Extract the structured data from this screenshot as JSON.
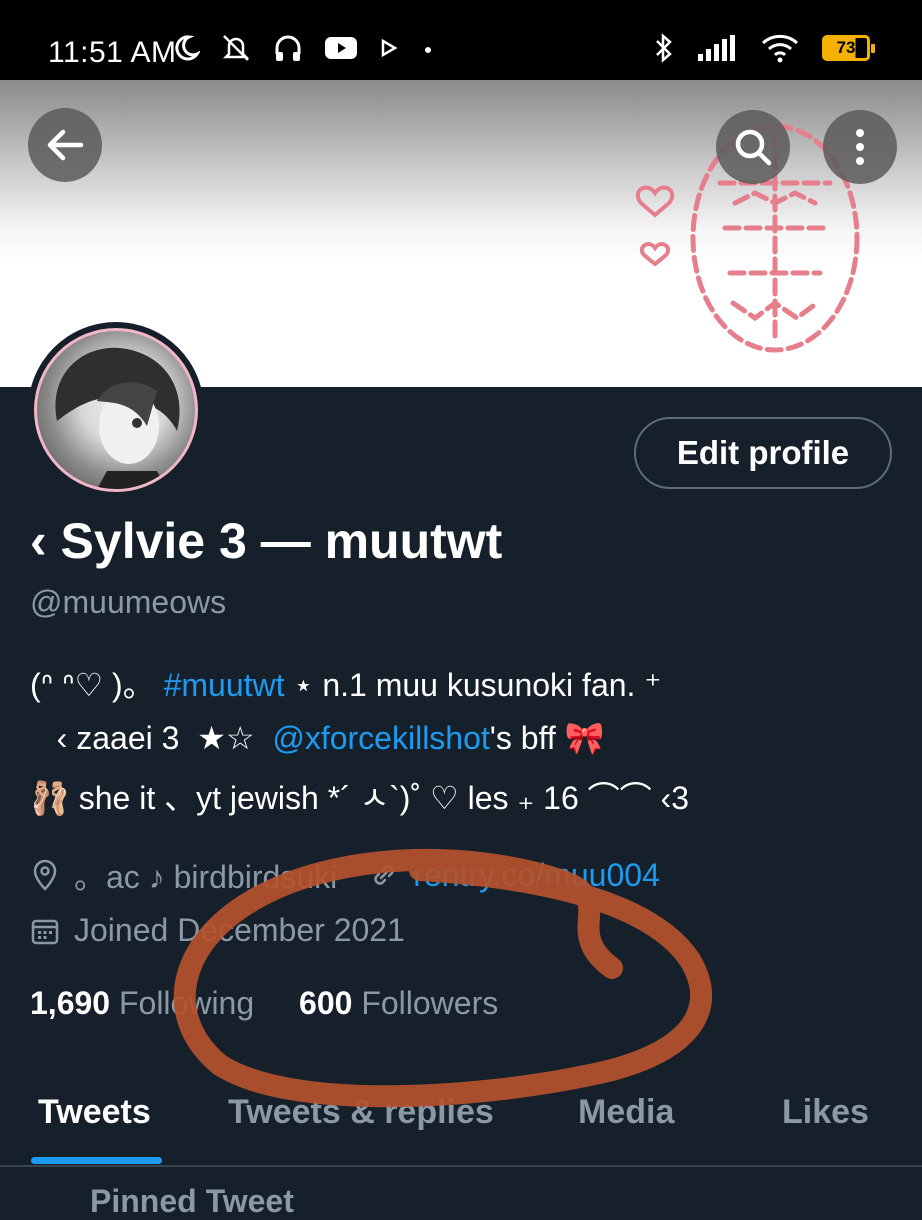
{
  "status_bar": {
    "time": "11:51 AM",
    "battery_level": "73",
    "icons": [
      "moon-icon",
      "muted-bell-icon",
      "headphones-icon",
      "youtube-icon",
      "play-icon",
      "dot-icon",
      "bluetooth-icon",
      "signal-icon",
      "wifi-icon",
      "battery-icon"
    ]
  },
  "header": {
    "back_icon": "arrow-left-icon",
    "search_icon": "search-icon",
    "more_icon": "more-vertical-icon"
  },
  "profile": {
    "edit_button": "Edit profile",
    "display_name": "‹ Sylvie 3 — muutwt",
    "handle": "@muumeows",
    "bio": {
      "line1_prefix": "(ᐢ ᐢ♡ )。 ",
      "line1_hashtag": "#muutwt",
      "line1_suffix": " ⋆ n.1 muu kusunoki fan. ⁺",
      "line2_prefix": "   ‹ zaaei 3  ★☆  ",
      "line2_mention": "@xforcekillshot",
      "line2_suffix": "'s bff 🎀",
      "line3": "🩰 she it 、yt jewish *´ ㅅ`)˚ ♡ les ₊ 16 ⌒⌒ ‹3"
    },
    "location": "。ac ♪ birdbirdsuki",
    "website": "rentry.co/muu004",
    "joined": "Joined December 2021",
    "following_count": "1,690",
    "following_label": "Following",
    "followers_count": "600",
    "followers_label": "Followers"
  },
  "tabs": [
    {
      "label": "Tweets",
      "active": true
    },
    {
      "label": "Tweets & replies",
      "active": false
    },
    {
      "label": "Media",
      "active": false
    },
    {
      "label": "Likes",
      "active": false
    }
  ],
  "pinned_label": "Pinned Tweet",
  "colors": {
    "background": "#15202b",
    "accent": "#1d9bf0",
    "secondary_text": "#8b98a5",
    "annotation": "#b5532d"
  }
}
